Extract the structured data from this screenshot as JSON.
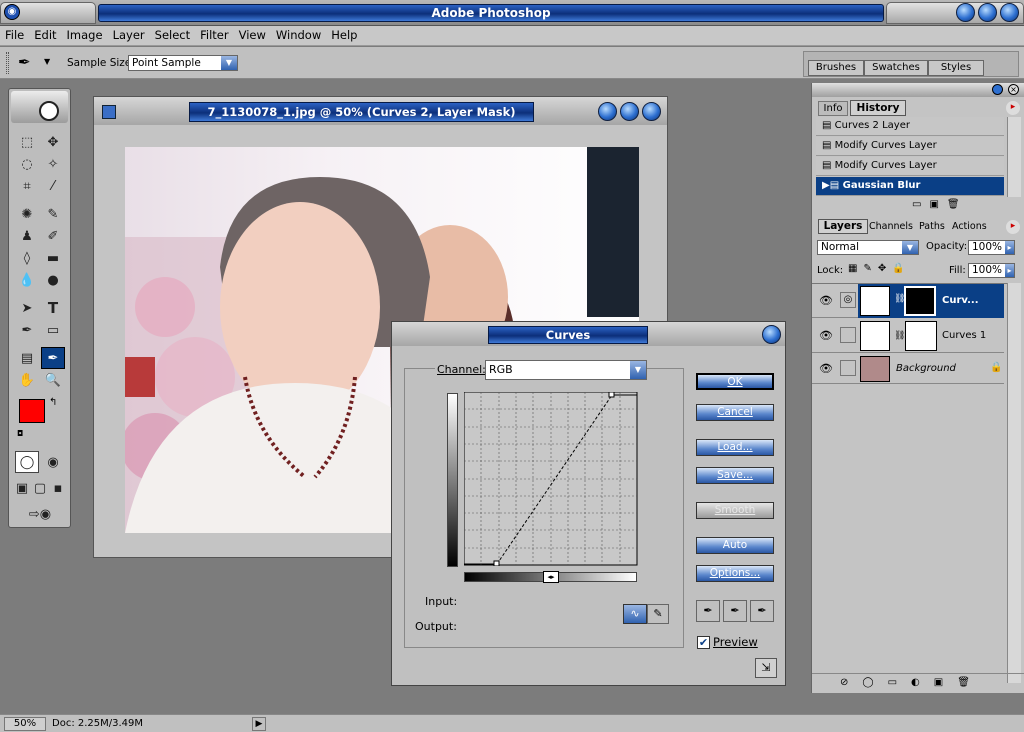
{
  "app": {
    "title": "Adobe Photoshop"
  },
  "menu": [
    "File",
    "Edit",
    "Image",
    "Layer",
    "Select",
    "Filter",
    "View",
    "Window",
    "Help"
  ],
  "options": {
    "sample_size_label": "Sample Size:",
    "sample_size_value": "Point Sample"
  },
  "palette_well": {
    "tabs": [
      "Brushes",
      "Swatches",
      "Styles"
    ]
  },
  "document": {
    "title": "7_1130078_1.jpg @ 50% (Curves 2, Layer Mask)"
  },
  "curves": {
    "title": "Curves",
    "channel_label": "Channel:",
    "channel_value": "RGB",
    "input_label": "Input:",
    "output_label": "Output:",
    "buttons": {
      "ok": "OK",
      "cancel": "Cancel",
      "load": "Load...",
      "save": "Save...",
      "smooth": "Smooth",
      "auto": "Auto",
      "options": "Options..."
    },
    "preview_label": "Preview",
    "preview_checked": true
  },
  "history": {
    "tabs": [
      "Info",
      "History"
    ],
    "items": [
      "Curves 2 Layer",
      "Modify Curves Layer",
      "Modify Curves Layer",
      "Gaussian Blur"
    ],
    "selected": "Gaussian Blur"
  },
  "layers": {
    "tabs": [
      "Layers",
      "Channels",
      "Paths",
      "Actions"
    ],
    "blend_mode": "Normal",
    "opacity_label": "Opacity:",
    "opacity_value": "100%",
    "lock_label": "Lock:",
    "fill_label": "Fill:",
    "fill_value": "100%",
    "items": [
      {
        "name": "Curv...",
        "selected": true
      },
      {
        "name": "Curves 1",
        "selected": false
      },
      {
        "name": "Background",
        "selected": false
      }
    ]
  },
  "status": {
    "zoom": "50%",
    "doc_info": "Doc: 2.25M/3.49M"
  },
  "colors": {
    "foreground": "#ff0000",
    "background": "#ffffff",
    "accent": "#0a3f86"
  }
}
